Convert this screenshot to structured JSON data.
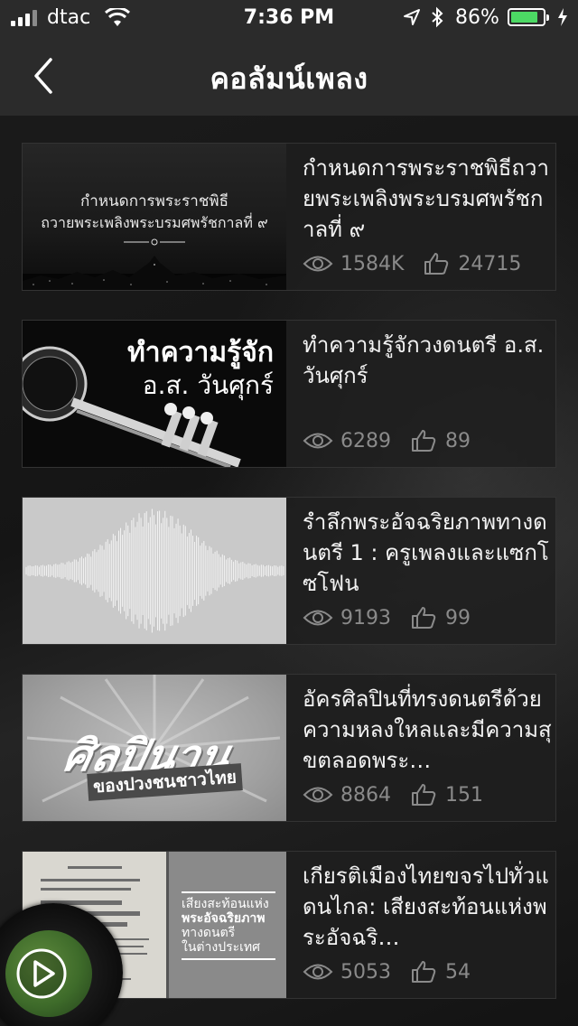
{
  "status_bar": {
    "carrier": "dtac",
    "time": "7:36 PM",
    "battery_percent": "86%",
    "battery_level": 0.86,
    "colors": {
      "battery_fill": "#4cd964"
    }
  },
  "nav": {
    "title": "คอลัมน์เพลง",
    "back_icon": "chevron-left-icon"
  },
  "items": [
    {
      "title": "กำหนดการพระราชพิธีถวายพระเพลิงพระบรมศพรัชกาลที่ ๙",
      "views": "1584K",
      "likes": "24715",
      "thumb_line1": "กำหนดการพระราชพิธี",
      "thumb_line2": "ถวายพระเพลิงพระบรมศพรัชกาลที่ ๙"
    },
    {
      "title": "ทำความรู้จักวงดนตรี อ.ส. วันศุกร์",
      "views": "6289",
      "likes": "89",
      "thumb_line1": "ทำความรู้จัก",
      "thumb_line2": "อ.ส. วันศุกร์"
    },
    {
      "title": "รำลึกพระอัจฉริยภาพทางดนตรี 1 : ครูเพลงและแซกโซโฟน",
      "views": "9193",
      "likes": "99"
    },
    {
      "title": "อัครศิลปินที่ทรงดนตรีด้วยความหลงใหลและมีความสุขตลอดพระ…",
      "views": "8864",
      "likes": "151",
      "thumb_line1": "ศิลปินาน",
      "thumb_line2": "ของปวงชนชาวไทย"
    },
    {
      "title": "เกียรติเมืองไทยขจรไปทั่วแดนไกล: เสียงสะท้อนแห่งพระอัจฉริ…",
      "views": "5053",
      "likes": "54",
      "thumb_line1": "เสียงสะท้อนแห่ง",
      "thumb_line2": "พระอัจฉริยภาพ",
      "thumb_line3": "ทางดนตรี",
      "thumb_line4": "ในต่างประเทศ"
    }
  ],
  "player": {
    "play_icon": "play-icon"
  }
}
